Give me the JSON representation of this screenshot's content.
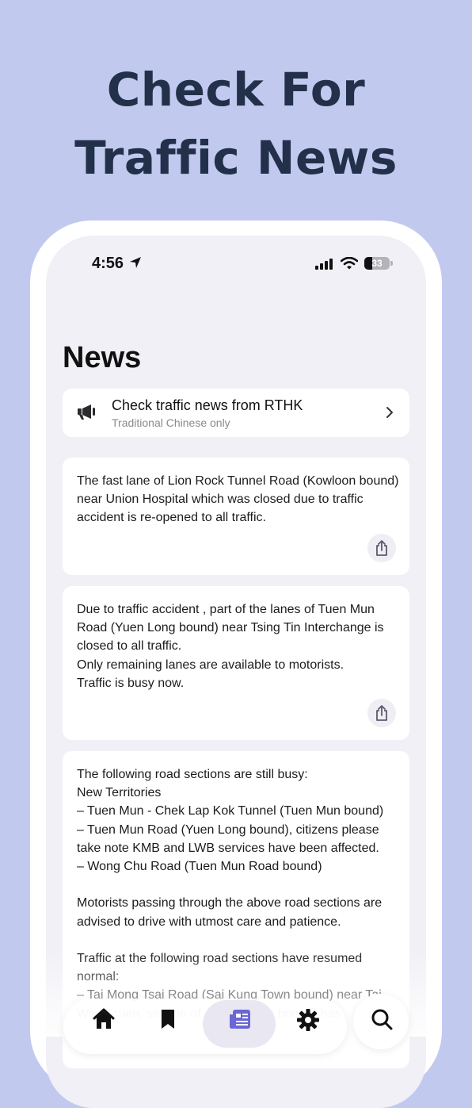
{
  "promo": {
    "headline_line1": "Check For",
    "headline_line2": "Traffic News"
  },
  "status_bar": {
    "time": "4:56",
    "battery": "33"
  },
  "page": {
    "title": "News"
  },
  "rthk_link": {
    "title": "Check traffic news from RTHK",
    "subtitle": "Traditional Chinese only",
    "icon": "megaphone-icon"
  },
  "news": [
    {
      "text": "The fast lane of Lion Rock Tunnel Road (Kowloon bound) near Union Hospital which was closed due to traffic accident is re-opened to all traffic."
    },
    {
      "text": "Due to traffic accident , part of the lanes of Tuen Mun Road (Yuen Long bound) near Tsing Tin Interchange is closed to all traffic.\nOnly remaining lanes are available to motorists.\nTraffic is busy now."
    },
    {
      "text": "The following road sections are still busy:\nNew Territories\n– Tuen Mun - Chek Lap Kok Tunnel (Tuen Mun bound)\n– Tuen Mun Road (Yuen Long bound), citizens please take note KMB and LWB services have been affected.\n– Wong Chu Road (Tuen Mun Road bound)\n\nMotorists passing through the above road sections are advised to drive with utmost care and patience.\n\nTraffic at the following road sections have resumed normal:\n– Tai Mong Tsai Road (Sai Kung Town bound) near Tai\nWan Tsuen, section of ... (Sai Kung bound) has"
    }
  ],
  "tab_bar": {
    "tabs": [
      "home-icon",
      "bookmark-icon",
      "news-icon",
      "gear-icon"
    ],
    "active": "news-icon",
    "search": "search-icon"
  },
  "colors": {
    "background": "#c2c9ef",
    "headline": "#22304a",
    "accent": "#6b67d4"
  }
}
